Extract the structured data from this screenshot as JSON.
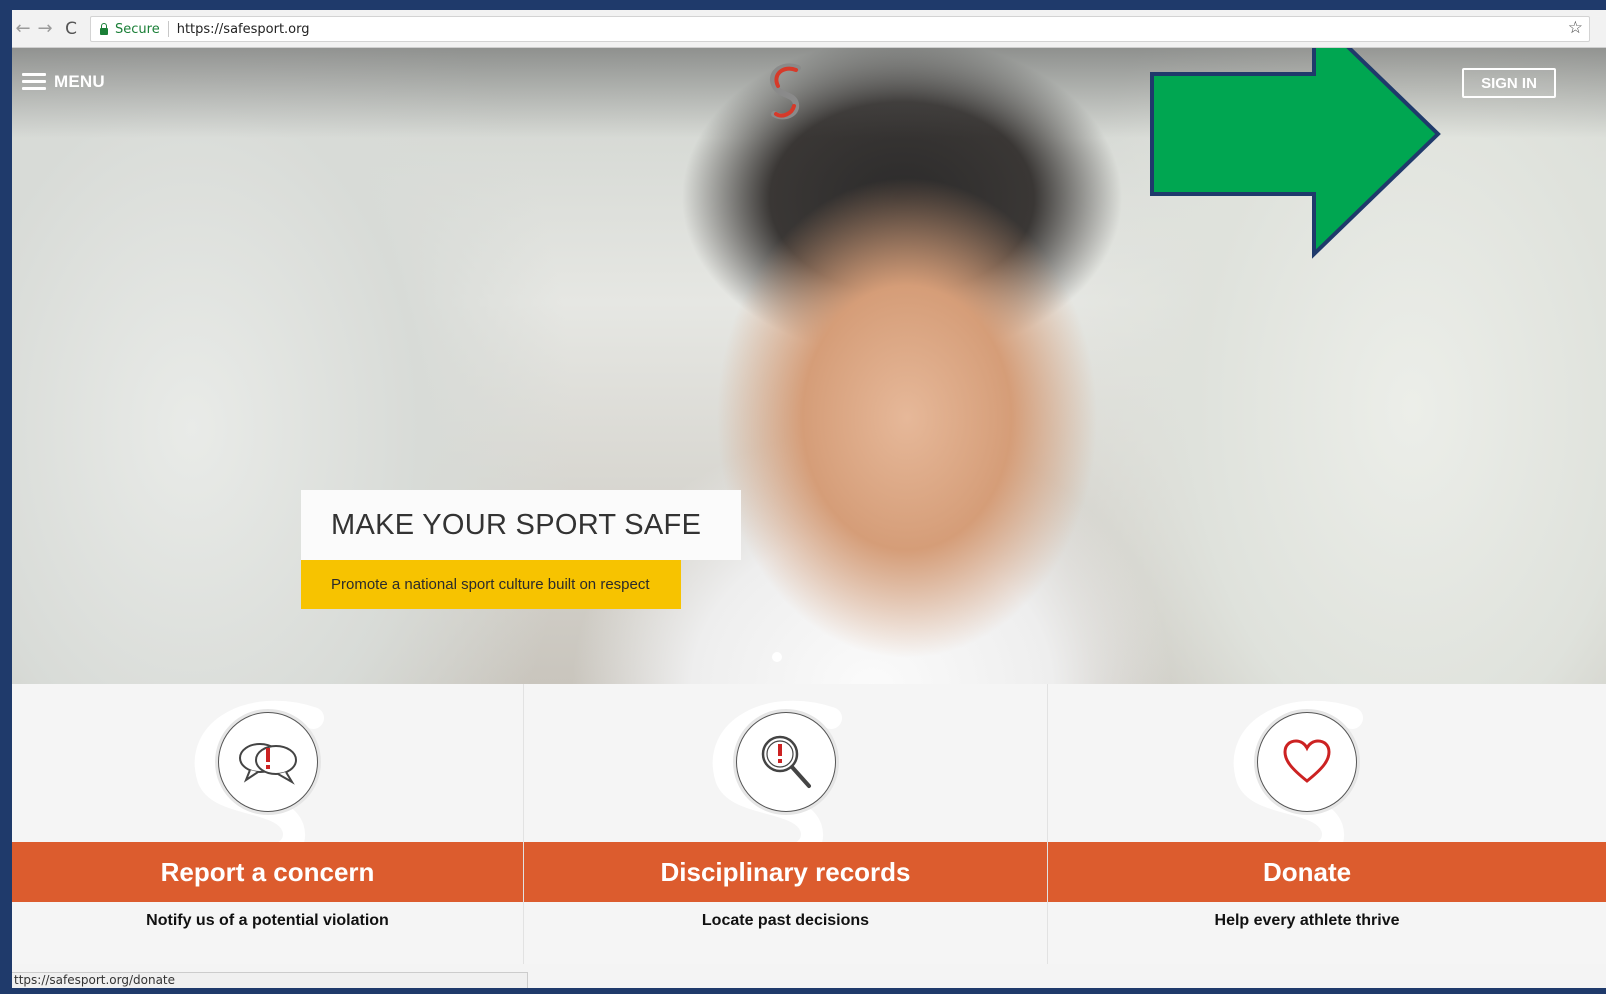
{
  "browser": {
    "secure_label": "Secure",
    "url": "https://safesport.org",
    "status_url": "ttps://safesport.org/donate"
  },
  "header": {
    "menu_label": "MENU",
    "signin_label": "SIGN IN"
  },
  "hero": {
    "headline": "MAKE YOUR SPORT SAFE",
    "tagline": "Promote a national sport culture built on respect"
  },
  "cards": [
    {
      "title": "Report a concern",
      "subtitle": "Notify us of a potential violation",
      "icon": "speech-bubbles-alert-icon"
    },
    {
      "title": "Disciplinary records",
      "subtitle": "Locate past decisions",
      "icon": "magnifier-alert-icon"
    },
    {
      "title": "Donate",
      "subtitle": "Help every athlete thrive",
      "icon": "heart-icon"
    }
  ],
  "colors": {
    "band_orange": "#dc5c2e",
    "tagline_yellow": "#f7c300",
    "annotation_arrow_green": "#00a651",
    "frame_blue": "#1f3a6b"
  }
}
